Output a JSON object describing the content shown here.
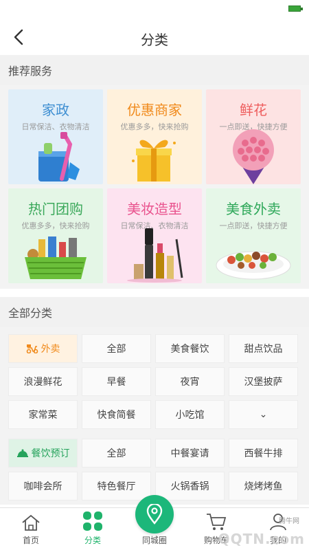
{
  "header": {
    "title": "分类"
  },
  "sections": {
    "recommended": "推荐服务",
    "all": "全部分类"
  },
  "services": [
    {
      "title": "家政",
      "subtitle": "日常保洁、衣物清洁",
      "bg": "#e0eef9",
      "color": "#3f8fd2",
      "icon": "cleaning-bucket-icon"
    },
    {
      "title": "优惠商家",
      "subtitle": "优惠多多，快来抢购",
      "bg": "#fff1dc",
      "color": "#f08a1c",
      "icon": "gift-box-icon"
    },
    {
      "title": "鲜花",
      "subtitle": "一点即送，快捷方便",
      "bg": "#fde3e3",
      "color": "#ee5e5e",
      "icon": "flower-bouquet-icon"
    },
    {
      "title": "热门团购",
      "subtitle": "优惠多多，快来抢购",
      "bg": "#e4f6e6",
      "color": "#3aa85a",
      "icon": "shopping-basket-icon"
    },
    {
      "title": "美妆造型",
      "subtitle": "日常保洁、衣物清洁",
      "bg": "#fde3f0",
      "color": "#e9538e",
      "icon": "cosmetics-icon"
    },
    {
      "title": "美食外卖",
      "subtitle": "一点即送，快捷方便",
      "bg": "#e6f7e8",
      "color": "#2fa85a",
      "icon": "food-plate-icon"
    }
  ],
  "categories": {
    "takeout": {
      "head": "外卖",
      "items": [
        "全部",
        "美食餐饮",
        "甜点饮品",
        "浪漫鲜花",
        "早餐",
        "夜宵",
        "汉堡披萨",
        "家常菜",
        "快食简餐",
        "小吃馆"
      ],
      "expand": "⌄"
    },
    "dining": {
      "head": "餐饮预订",
      "items": [
        "全部",
        "中餐宴请",
        "西餐牛排",
        "咖啡会所",
        "特色餐厅",
        "火锅香锅",
        "烧烤烤鱼"
      ]
    }
  },
  "tabbar": {
    "home": "首页",
    "category": "分类",
    "city": "同城圈",
    "cart": "购物车",
    "mine": "我的"
  },
  "watermark": {
    "small": "腾牛网",
    "big": "QQTN.com"
  }
}
